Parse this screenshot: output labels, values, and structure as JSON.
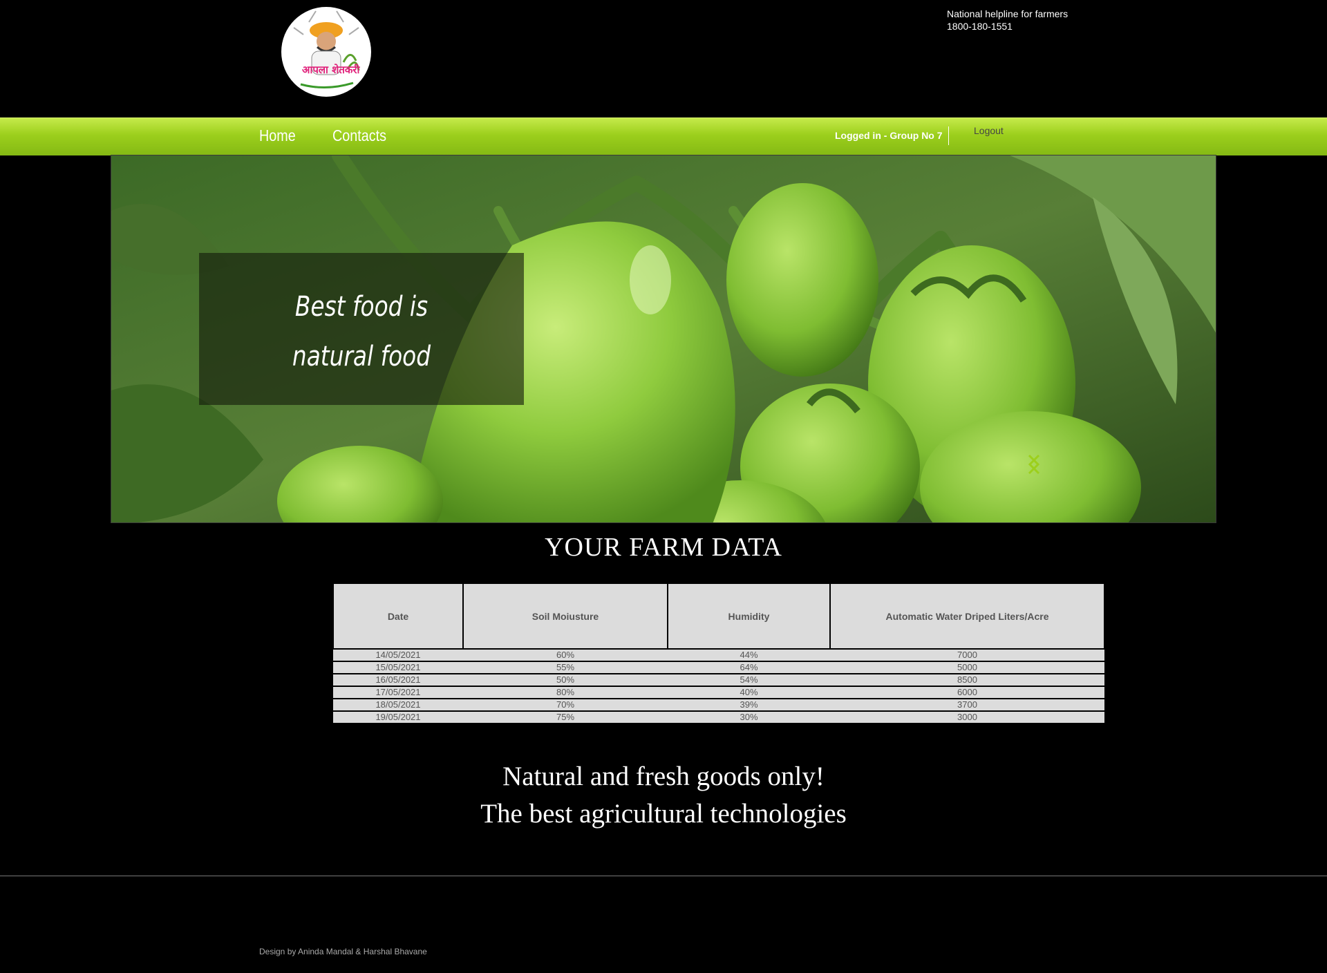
{
  "header": {
    "logo_text": "आपला शेतकरी",
    "helpline_label": "National helpline for farmers",
    "helpline_number": "1800-180-1551"
  },
  "nav": {
    "home": "Home",
    "contacts": "Contacts",
    "logged_in": "Logged in - Group No 7",
    "logout": "Logout"
  },
  "hero": {
    "caption_line1": "Best food is",
    "caption_line2": "natural food",
    "accent_color": "#9ccf1c"
  },
  "farm": {
    "title": "YOUR FARM DATA",
    "columns": [
      "Date",
      "Soil Moiusture",
      "Humidity",
      "Automatic Water Driped Liters/Acre"
    ],
    "rows": [
      [
        "14/05/2021",
        "60%",
        "44%",
        "7000"
      ],
      [
        "15/05/2021",
        "55%",
        "64%",
        "5000"
      ],
      [
        "16/05/2021",
        "50%",
        "54%",
        "8500"
      ],
      [
        "17/05/2021",
        "80%",
        "40%",
        "6000"
      ],
      [
        "18/05/2021",
        "70%",
        "39%",
        "3700"
      ],
      [
        "19/05/2021",
        "75%",
        "30%",
        "3000"
      ]
    ]
  },
  "tagline": {
    "line1": "Natural and fresh goods only!",
    "line2": "The best agricultural technologies"
  },
  "footer": {
    "credits": "Design by Aninda Mandal & Harshal Bhavane"
  }
}
